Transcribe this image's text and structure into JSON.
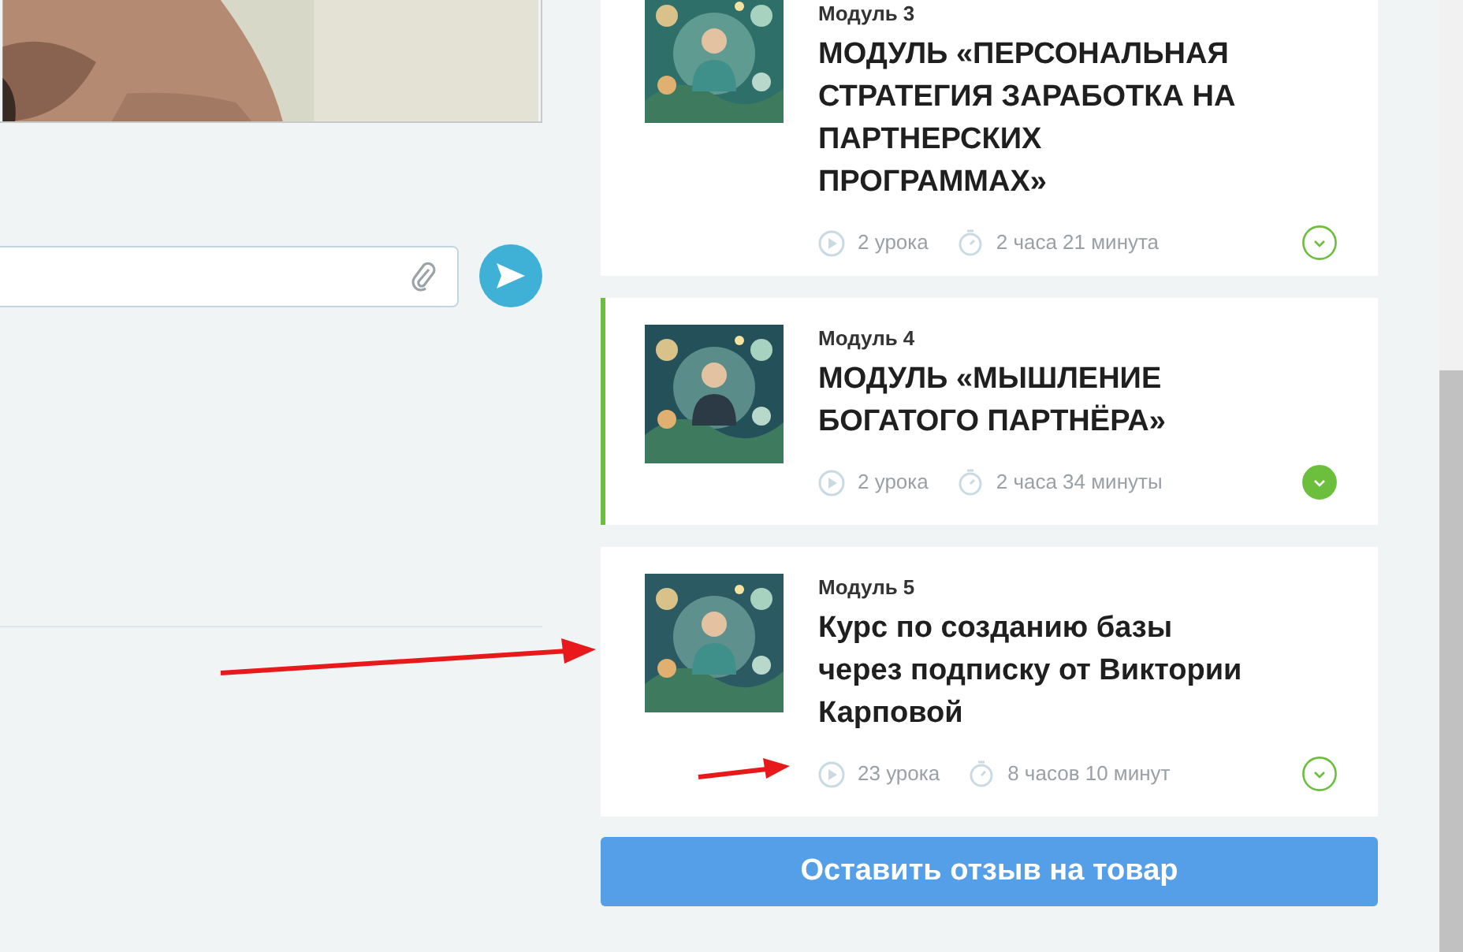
{
  "modules": [
    {
      "label": "Модуль 3",
      "title": "МОДУЛЬ «ПЕРСОНАЛЬНАЯ СТРАТЕГИЯ ЗАРАБОТКА НА ПАРТНЕРСКИХ ПРОГРАММАХ»",
      "lessons": "2 урока",
      "duration": "2 часа 21 минута",
      "selected": false
    },
    {
      "label": "Модуль 4",
      "title": "МОДУЛЬ «МЫШЛЕНИЕ БОГАТОГО ПАРТНЁРА»",
      "lessons": "2 урока",
      "duration": "2 часа 34 минуты",
      "selected": true
    },
    {
      "label": "Модуль 5",
      "title": "Курс по созданию базы через подписку от Виктории Карповой",
      "lessons": "23 урока",
      "duration": "8 часов 10 минут",
      "selected": false
    }
  ],
  "review_button": "Оставить отзыв на товар"
}
